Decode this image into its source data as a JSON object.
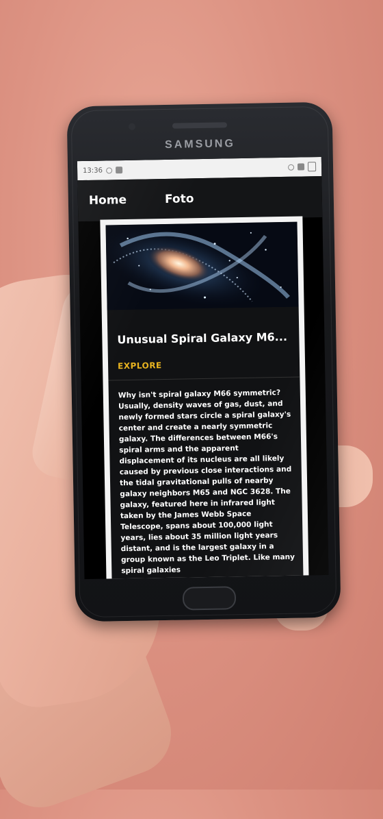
{
  "phone": {
    "brand": "SAMSUNG"
  },
  "statusbar": {
    "time": "13:36"
  },
  "nav": {
    "items": [
      {
        "label": "Home"
      },
      {
        "label": "Foto"
      }
    ]
  },
  "card": {
    "image_alt": "Spiral galaxy M66 infrared image",
    "title": "Unusual Spiral Galaxy M6...",
    "explore_label": "EXPLORE",
    "description": "Why isn't spiral galaxy M66 symmetric? Usually, density waves of gas, dust, and newly formed stars circle a spiral galaxy's center and create a nearly symmetric galaxy. The differences between M66's spiral arms and the apparent displacement of its nucleus are all likely caused by previous close interactions and the tidal gravitational pulls of nearby galaxy neighbors M65 and NGC 3628. The galaxy, featured here in infrared light taken by the James Webb Space Telescope, spans about 100,000 light years, lies about 35 million light years distant, and is the largest galaxy in a group known as the Leo Triplet. Like many spiral galaxies"
  },
  "colors": {
    "accent": "#e8b320",
    "navbar": "#141517",
    "card": "#111214"
  }
}
